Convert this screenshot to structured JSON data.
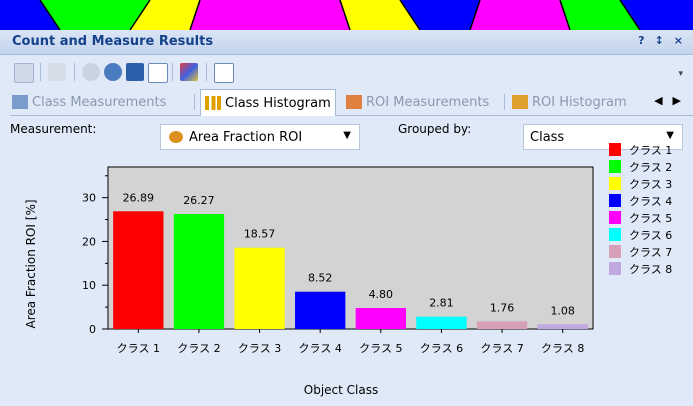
{
  "title": "Count and Measure Results",
  "window_controls": {
    "help": "?",
    "pin": "↕",
    "close": "×"
  },
  "toolbar_icons": [
    "pointer-icon",
    "eyedropper-icon",
    "zoom-out-icon",
    "zoom-in-icon",
    "fit-icon",
    "line-chart-icon",
    "color-icon",
    "export-icon"
  ],
  "tabs": [
    {
      "label": "Class Measurements",
      "active": false,
      "icon": "table-icon"
    },
    {
      "label": "Class Histogram",
      "active": true,
      "icon": "histogram-icon"
    },
    {
      "label": "ROI Measurements",
      "active": false,
      "icon": "roi-table-icon"
    },
    {
      "label": "ROI Histogram",
      "active": false,
      "icon": "roi-histogram-icon"
    }
  ],
  "tab_nav": {
    "prev": "◀",
    "next": "▶"
  },
  "measurement": {
    "label": "Measurement:",
    "value": "Area Fraction ROI",
    "arrow": "▼"
  },
  "grouped_by": {
    "label": "Grouped by:",
    "value": "Class",
    "arrow": "▼"
  },
  "chart_data": {
    "type": "bar",
    "categories": [
      "クラス 1",
      "クラス 2",
      "クラス 3",
      "クラス 4",
      "クラス 5",
      "クラス 6",
      "クラス 7",
      "クラス 8"
    ],
    "values": [
      26.89,
      26.27,
      18.57,
      8.52,
      4.8,
      2.81,
      1.76,
      1.08
    ],
    "value_labels": [
      "26.89",
      "26.27",
      "18.57",
      "8.52",
      "4.80",
      "2.81",
      "1.76",
      "1.08"
    ],
    "colors": [
      "#ff0000",
      "#00ff00",
      "#ffff00",
      "#0000ff",
      "#ff00ff",
      "#00ffff",
      "#d8a0b8",
      "#c0a8e0"
    ],
    "xlabel": "Object Class",
    "ylabel": "Area Fraction ROI [%]",
    "ylim": [
      0,
      37
    ],
    "yticks": [
      0,
      10,
      20,
      30
    ],
    "legend": [
      "クラス 1",
      "クラス 2",
      "クラス 3",
      "クラス 4",
      "クラス 5",
      "クラス 6",
      "クラス 7",
      "クラス 8"
    ],
    "legend_position": "right",
    "grid": false
  }
}
